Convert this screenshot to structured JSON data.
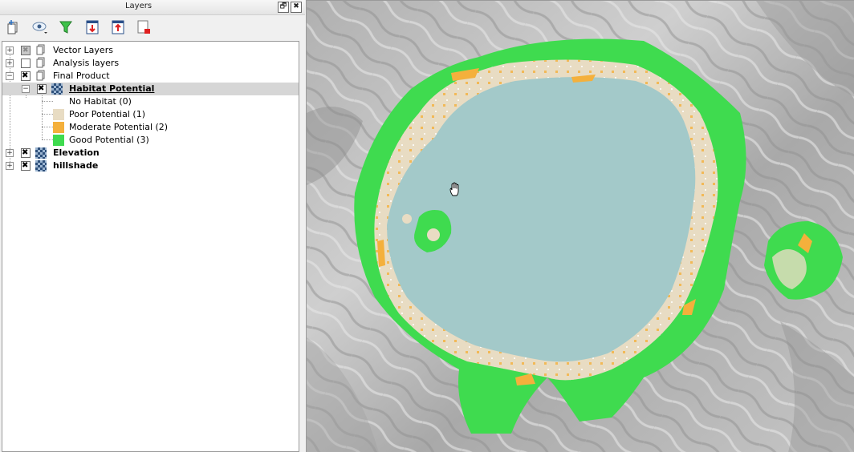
{
  "panel": {
    "title": "Layers",
    "float_label": "🗗",
    "close_label": "✖"
  },
  "toolbar": {
    "tools": [
      "add-group-icon",
      "visibility-menu-icon",
      "filter-icon",
      "expand-all-icon",
      "collapse-all-icon",
      "remove-layer-icon"
    ]
  },
  "tree": {
    "groups": [
      {
        "label": "Vector Layers",
        "state": "partial"
      },
      {
        "label": "Analysis layers",
        "state": "unchecked"
      },
      {
        "label": "Final Product",
        "state": "checked"
      }
    ],
    "habitat_layer": {
      "label": "Habitat Potential",
      "legend": [
        {
          "label": "No Habitat (0)",
          "color": "#ffffff"
        },
        {
          "label": "Poor Potential (1)",
          "color": "#e8dcc3"
        },
        {
          "label": "Moderate Potential (2)",
          "color": "#f4b03c"
        },
        {
          "label": "Good Potential (3)",
          "color": "#3fdb4f"
        }
      ]
    },
    "layers": [
      {
        "label": "Elevation"
      },
      {
        "label": "hillshade"
      }
    ]
  },
  "map": {
    "lake_color": "#a3c9c9",
    "good_color": "#3fdb4f",
    "moderate_color": "#f4b03c",
    "poor_color": "#e8dcc3",
    "hillshade_color": "#bdbdbd"
  }
}
